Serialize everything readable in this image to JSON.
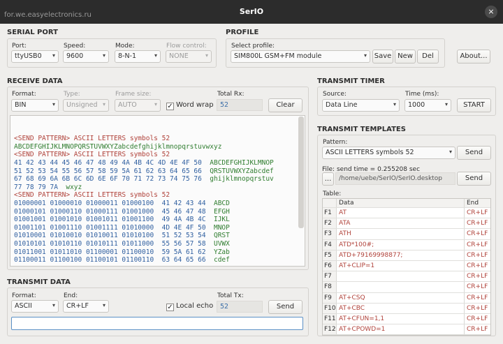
{
  "window": {
    "title": "SerIO",
    "watermark": "for.we.easyelectronics.ru",
    "close_glyph": "×"
  },
  "serial_port": {
    "heading": "SERIAL PORT",
    "port_label": "Port:",
    "port_value": "ttyUSB0",
    "speed_label": "Speed:",
    "speed_value": "9600",
    "mode_label": "Mode:",
    "mode_value": "8-N-1",
    "flow_label": "Flow control:",
    "flow_value": "NONE"
  },
  "profile": {
    "heading": "PROFILE",
    "select_label": "Select profile:",
    "select_value": "SIM800L GSM+FM module",
    "save": "Save",
    "new": "New",
    "del": "Del",
    "about": "About..."
  },
  "receive": {
    "heading": "RECEIVE DATA",
    "format_label": "Format:",
    "format_value": "BIN",
    "type_label": "Type:",
    "type_value": "Unsigned",
    "frame_label": "Frame size:",
    "frame_value": "AUTO",
    "wordwrap_label": "Word wrap",
    "wordwrap_checked": true,
    "total_label": "Total Rx:",
    "total_value": "52",
    "clear": "Clear",
    "lines": [
      {
        "kind": "send",
        "text": "<SEND PATTERN> ASCII LETTERS symbols 52"
      },
      {
        "kind": "ascii",
        "text": "ABCDEFGHIJKLMNOPQRSTUVWXYZabcdefghijklmnopqrstuvwxyz"
      },
      {
        "kind": "send",
        "text": "<SEND PATTERN> ASCII LETTERS symbols 52"
      },
      {
        "kind": "hex",
        "hex": "41 42 43 44 45 46 47 48 49 4A 4B 4C 4D 4E 4F 50  ",
        "txt": "ABCDEFGHIJKLMNOP"
      },
      {
        "kind": "hex",
        "hex": "51 52 53 54 55 56 57 58 59 5A 61 62 63 64 65 66  ",
        "txt": "QRSTUVWXYZabcdef"
      },
      {
        "kind": "hex",
        "hex": "67 68 69 6A 6B 6C 6D 6E 6F 70 71 72 73 74 75 76  ",
        "txt": "ghijklmnopqrstuv"
      },
      {
        "kind": "hex",
        "hex": "77 78 79 7A  ",
        "txt": "wxyz"
      },
      {
        "kind": "send",
        "text": "<SEND PATTERN> ASCII LETTERS symbols 52"
      },
      {
        "kind": "hex",
        "hex": "01000001 01000010 01000011 01000100  41 42 43 44  ",
        "txt": "ABCD"
      },
      {
        "kind": "hex",
        "hex": "01000101 01000110 01000111 01001000  45 46 47 48  ",
        "txt": "EFGH"
      },
      {
        "kind": "hex",
        "hex": "01001001 01001010 01001011 01001100  49 4A 4B 4C  ",
        "txt": "IJKL"
      },
      {
        "kind": "hex",
        "hex": "01001101 01001110 01001111 01010000  4D 4E 4F 50  ",
        "txt": "MNOP"
      },
      {
        "kind": "hex",
        "hex": "01010001 01010010 01010011 01010100  51 52 53 54  ",
        "txt": "QRST"
      },
      {
        "kind": "hex",
        "hex": "01010101 01010110 01010111 01011000  55 56 57 58  ",
        "txt": "UVWX"
      },
      {
        "kind": "hex",
        "hex": "01011001 01011010 01100001 01100010  59 5A 61 62  ",
        "txt": "YZab"
      },
      {
        "kind": "hex",
        "hex": "01100011 01100100 01100101 01100110  63 64 65 66  ",
        "txt": "cdef"
      }
    ]
  },
  "transmit": {
    "heading": "TRANSMIT DATA",
    "format_label": "Format:",
    "format_value": "ASCII",
    "end_label": "End:",
    "end_value": "CR+LF",
    "localecho_label": "Local echo",
    "localecho_checked": true,
    "total_label": "Total Tx:",
    "total_value": "52",
    "send": "Send",
    "input_value": ""
  },
  "timer": {
    "heading": "TRANSMIT TIMER",
    "source_label": "Source:",
    "source_value": "Data Line",
    "time_label": "Time (ms):",
    "time_value": "1000",
    "start": "START"
  },
  "templates": {
    "heading": "TRANSMIT TEMPLATES",
    "pattern_label": "Pattern:",
    "pattern_value": "ASCII LETTERS symbols 52",
    "send": "Send",
    "file_label": "File:",
    "file_info": "send time = 0.255208 sec",
    "browse": "...",
    "file_path": "/home/uebe/SerIO/SerIO.desktop",
    "file_send": "Send",
    "table_label": "Table:",
    "col_data": "Data",
    "col_end": "End",
    "rows": [
      {
        "key": "F1",
        "data": "AT",
        "end": "CR+LF"
      },
      {
        "key": "F2",
        "data": "ATA",
        "end": "CR+LF"
      },
      {
        "key": "F3",
        "data": "ATH",
        "end": "CR+LF"
      },
      {
        "key": "F4",
        "data": "ATD*100#;",
        "end": "CR+LF"
      },
      {
        "key": "F5",
        "data": "ATD+79169998877;",
        "end": "CR+LF"
      },
      {
        "key": "F6",
        "data": "AT+CLIP=1",
        "end": "CR+LF"
      },
      {
        "key": "F7",
        "data": "",
        "end": "CR+LF"
      },
      {
        "key": "F8",
        "data": "",
        "end": "CR+LF"
      },
      {
        "key": "F9",
        "data": "AT+CSQ",
        "end": "CR+LF"
      },
      {
        "key": "F10",
        "data": "AT+CBC",
        "end": "CR+LF"
      },
      {
        "key": "F11",
        "data": "AT+CFUN=1,1",
        "end": "CR+LF"
      },
      {
        "key": "F12",
        "data": "AT+CPOWD=1",
        "end": "CR+LF"
      }
    ]
  }
}
